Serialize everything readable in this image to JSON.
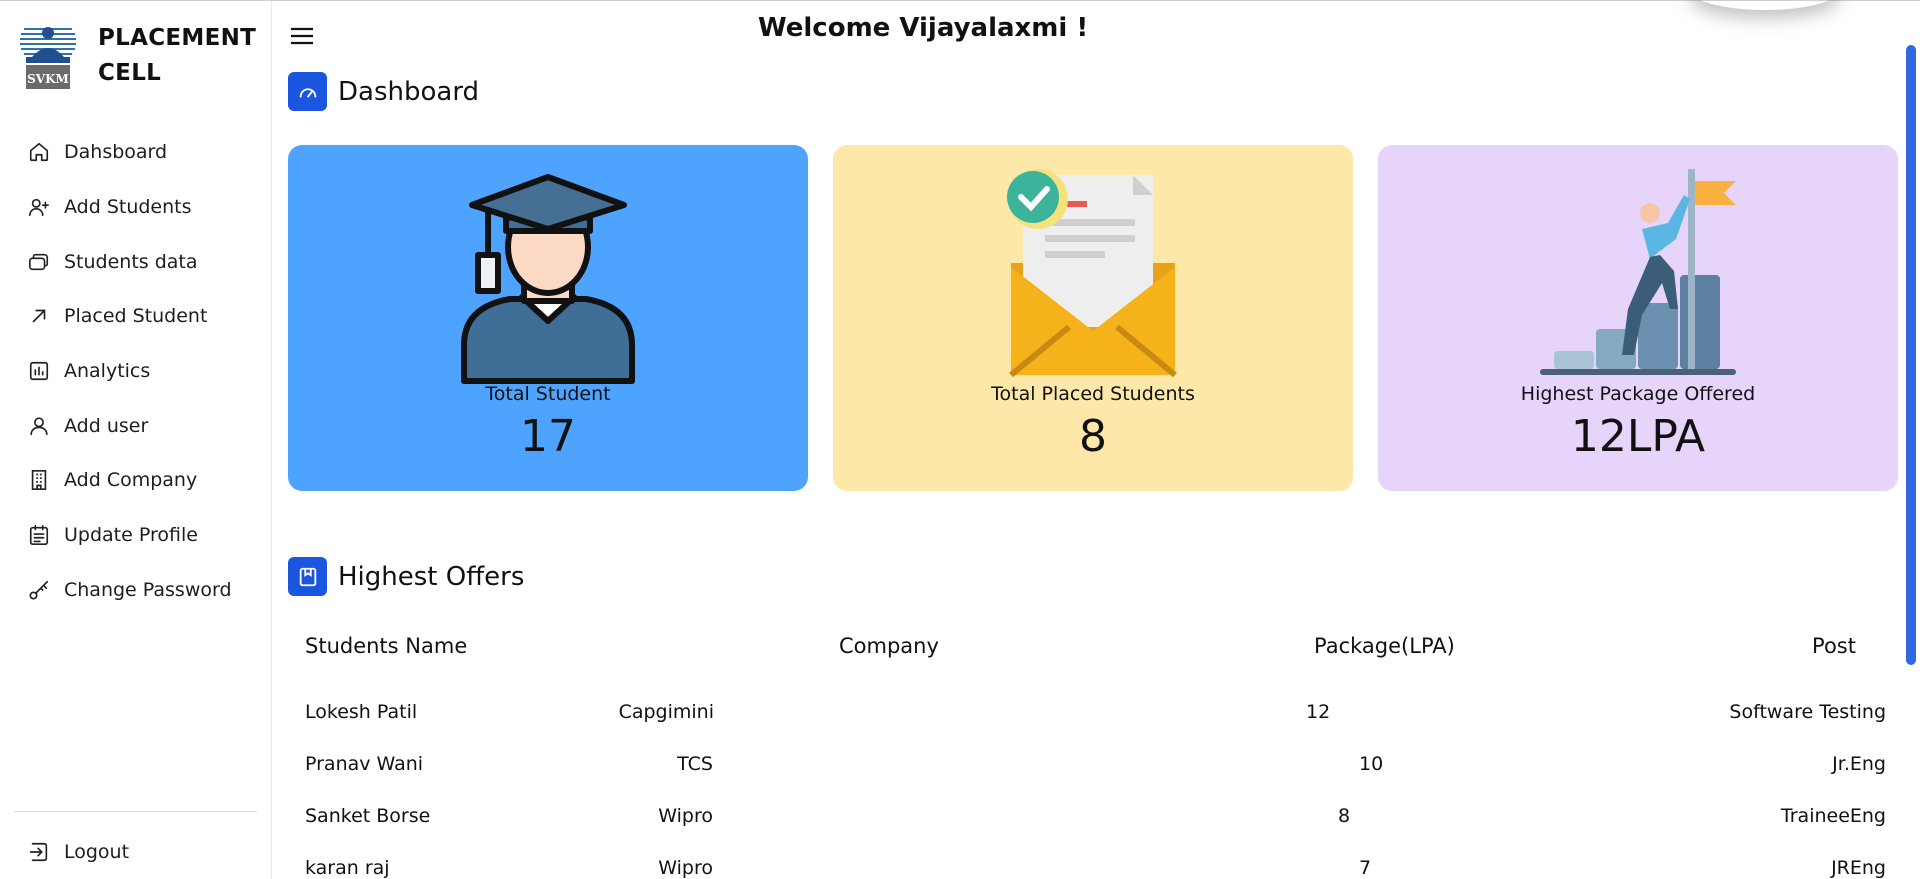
{
  "brand": {
    "line1": "PLACEMENT",
    "line2": "CELL",
    "logo_text": "SVKM"
  },
  "header": {
    "welcome": "Welcome Vijayalaxmi !"
  },
  "sidebar": {
    "items": [
      {
        "label": "Dahsboard",
        "icon": "home-icon"
      },
      {
        "label": "Add Students",
        "icon": "user-plus-icon"
      },
      {
        "label": "Students data",
        "icon": "database-icon"
      },
      {
        "label": "Placed Student",
        "icon": "arrow-up-right-icon"
      },
      {
        "label": "Analytics",
        "icon": "bar-chart-icon"
      },
      {
        "label": "Add user",
        "icon": "user-icon"
      },
      {
        "label": "Add Company",
        "icon": "building-icon"
      },
      {
        "label": "Update Profile",
        "icon": "calendar-icon"
      },
      {
        "label": "Change Password",
        "icon": "key-icon"
      }
    ],
    "logout": {
      "label": "Logout",
      "icon": "logout-icon"
    }
  },
  "dashboard": {
    "title": "Dashboard"
  },
  "cards": [
    {
      "label": "Total Student",
      "value": "17",
      "color": "#4ea3ff",
      "icon": "graduate-icon"
    },
    {
      "label": "Total Placed Students",
      "value": "8",
      "color": "#fde7a9",
      "icon": "envelope-letter-icon"
    },
    {
      "label": "Highest Package Offered",
      "value": "12LPA",
      "color": "#e6d4fb",
      "icon": "climber-flag-icon"
    }
  ],
  "offers": {
    "title": "Highest Offers",
    "columns": [
      "Students Name",
      "Company",
      "Package(LPA)",
      "Post"
    ],
    "rows": [
      {
        "name": "Lokesh Patil",
        "company": "Capgimini",
        "package": "12",
        "post": "Software Testing"
      },
      {
        "name": "Pranav Wani",
        "company": "TCS",
        "package": "10",
        "post": "Jr.Eng"
      },
      {
        "name": "Sanket Borse",
        "company": "Wipro",
        "package": "8",
        "post": "TraineeEng"
      },
      {
        "name": "karan raj",
        "company": "Wipro",
        "package": "7",
        "post": "JREng"
      }
    ]
  },
  "colors": {
    "accent": "#1a56e0"
  }
}
